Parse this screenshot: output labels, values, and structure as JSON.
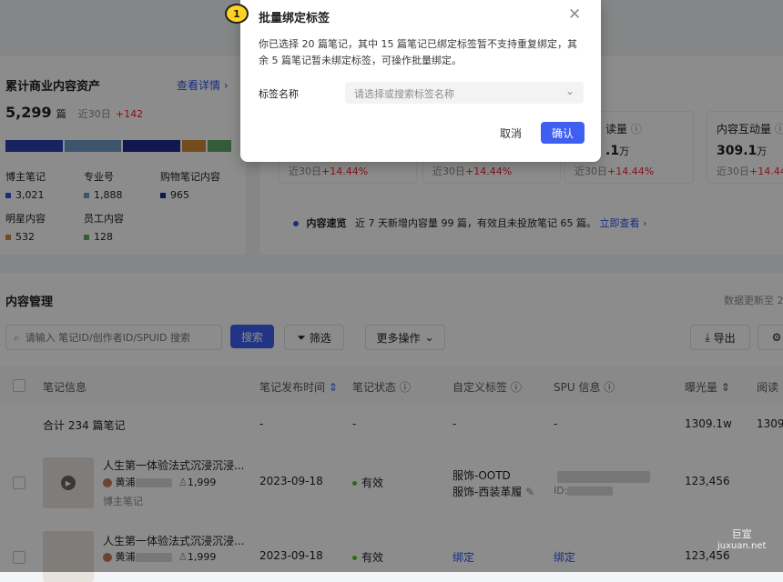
{
  "assets": {
    "title": "累计商业内容资产",
    "detail_link": "查看详情",
    "total_value": "5,299",
    "total_unit": "篇",
    "period": "近30日",
    "delta": "+142",
    "bar_colors": [
      "#2f3fb0",
      "#6e9bc5",
      "#1f2d8c",
      "#d08a3a",
      "#5fa86c"
    ],
    "categories": [
      {
        "label": "博主笔记",
        "value": "3,021",
        "color": "#2f54eb"
      },
      {
        "label": "专业号",
        "value": "1,888",
        "color": "#6e9bc5"
      },
      {
        "label": "购物笔记内容",
        "value": "965",
        "color": "#1f2d8c"
      },
      {
        "label": "明星内容",
        "value": "532",
        "color": "#d08a3a"
      },
      {
        "label": "员工内容",
        "value": "128",
        "color": "#5fa86c"
      }
    ]
  },
  "metrics": [
    {
      "label": "",
      "value": "",
      "unit": "",
      "period": "近30日",
      "delta": "+14.44%"
    },
    {
      "label": "",
      "value": "",
      "unit": "",
      "period": "近30日",
      "delta": "+14.44%"
    },
    {
      "label": "读量",
      "value": ".1",
      "unit": "万",
      "period": "近30日",
      "delta": "+14.44%"
    },
    {
      "label": "内容互动量",
      "value": "309.1",
      "unit": "万",
      "period": "近30日",
      "delta": "+14.44%"
    }
  ],
  "speed": {
    "label": "内容速览",
    "text": "近 7 天新增内容量 99 篇，有效且未投放笔记 65 篇。",
    "link": "立即查看"
  },
  "management": {
    "title": "内容管理",
    "update_note": "数据更新至 2",
    "search_placeholder": "请输入 笔记ID/创作者ID/SPUID 搜索",
    "search_button": "搜索",
    "filter_button": "筛选",
    "more_button": "更多操作",
    "export_button": "导出"
  },
  "table": {
    "headers": [
      "笔记信息",
      "笔记发布时间",
      "笔记状态",
      "自定义标签",
      "SPU 信息",
      "曝光量",
      "阅读"
    ],
    "summary": {
      "label": "合计 234 篇笔记",
      "dash": "-",
      "exposure": "1309.1w",
      "read": "1309"
    },
    "rows": [
      {
        "title": "人生第一体验法式沉浸沉浸...",
        "author": "黄浦",
        "likes": "1,999",
        "type": "博主笔记",
        "date": "2023-09-18",
        "status": "有效",
        "tag1": "服饰-OOTD",
        "tag2": "服饰-西装革履",
        "spu_id": "ID:",
        "exposure": "123,456"
      },
      {
        "title": "人生第一体验法式沉浸沉浸...",
        "author": "黄浦",
        "likes": "1,999",
        "type": "",
        "date": "2023-09-18",
        "status": "有效",
        "tag1": "绑定",
        "tag2": "",
        "spu_id": "绑定",
        "exposure": "123,456"
      }
    ]
  },
  "modal": {
    "step": "1",
    "title": "批量绑定标签",
    "desc_line1": "你已选择 20 篇笔记，其中 15 篇笔记已绑定标签暂不支持重复绑定，其",
    "desc_line2": "余 5 篇笔记暂未绑定标签，可操作批量绑定。",
    "field_label": "标签名称",
    "select_placeholder": "请选择或搜索标签名称",
    "cancel": "取消",
    "confirm": "确认",
    "primary_color": "#3f5ff0"
  },
  "watermark": {
    "name": "巨宣",
    "domain": "juxuan.net"
  }
}
